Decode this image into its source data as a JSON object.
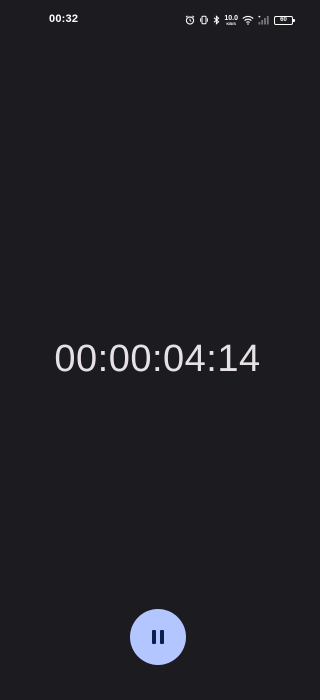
{
  "status_bar": {
    "time": "00:32",
    "net_speed_value": "10.0",
    "net_speed_unit": "KB/S",
    "battery_level": "60",
    "icons": [
      "alarm-icon",
      "vibrate-icon",
      "bluetooth-icon",
      "wifi-icon",
      "signal-icon",
      "battery-icon"
    ]
  },
  "stopwatch": {
    "elapsed": "00:00:04:14"
  },
  "controls": {
    "pause_icon": "pause-icon"
  },
  "colors": {
    "background": "#1c1b1f",
    "text": "#e6e1e5",
    "button_fill": "#b3c6ff",
    "button_icon": "#0b1f4d"
  }
}
